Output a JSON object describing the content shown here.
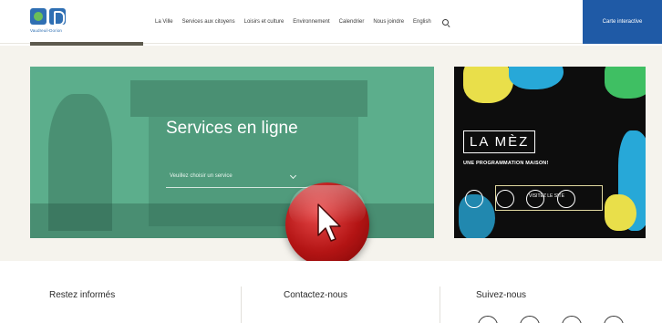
{
  "header": {
    "logo_text": "Vaudreuil-Dorion",
    "nav": [
      "La Ville",
      "Services aux citoyens",
      "Loisirs et culture",
      "Environnement",
      "Calendrier",
      "Nous joindre",
      "English"
    ],
    "map_button": "Carte interactive"
  },
  "services": {
    "title": "Services en ligne",
    "select_placeholder": "Veuillez choisir un service"
  },
  "mez": {
    "logo": "LA MÈZ",
    "tagline": "UNE PROGRAMMATION MAISON!",
    "button_label": "VISITEZ LE SITE",
    "colors": {
      "yellow": "#e9df4a",
      "green": "#3fbf63",
      "blue": "#27a8d8"
    }
  },
  "footer": {
    "col1": "Restez informés",
    "col2": "Contactez-nous",
    "col3": "Suivez-nous"
  },
  "colors": {
    "accent_blue": "#1f5aa6",
    "services_green": "#5cae8c",
    "band_beige": "#f5f3ed",
    "cursor_red": "#b31414"
  }
}
